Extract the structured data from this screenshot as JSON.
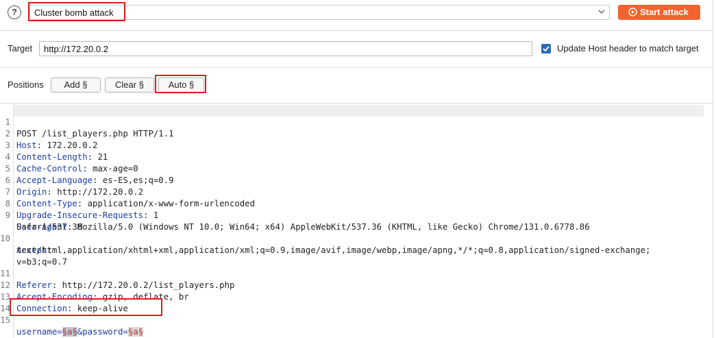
{
  "attack_type": {
    "help_icon": "question-circle-icon",
    "selected": "Cluster bomb attack",
    "start_button": "Start attack"
  },
  "target": {
    "label": "Target",
    "value": "http://172.20.0.2",
    "update_host_checked": true,
    "update_host_label": "Update Host header to match target"
  },
  "positions": {
    "label": "Positions",
    "add": "Add §",
    "clear": "Clear §",
    "auto": "Auto §"
  },
  "request": {
    "lines": [
      {
        "n": "1",
        "text": "POST /list_players.php HTTP/1.1"
      },
      {
        "n": "2",
        "key": "Host",
        "value": "172.20.0.2"
      },
      {
        "n": "3",
        "key": "Content-Length",
        "value": "21"
      },
      {
        "n": "4",
        "key": "Cache-Control",
        "value": "max-age=0"
      },
      {
        "n": "5",
        "key": "Accept-Language",
        "value": "es-ES,es;q=0.9"
      },
      {
        "n": "6",
        "key": "Origin",
        "value": "http://172.20.0.2"
      },
      {
        "n": "7",
        "key": "Content-Type",
        "value": "application/x-www-form-urlencoded"
      },
      {
        "n": "8",
        "key": "Upgrade-Insecure-Requests",
        "value": "1"
      },
      {
        "n": "9",
        "key": "User-Agent",
        "value": "Mozilla/5.0 (Windows NT 10.0; Win64; x64) AppleWebKit/537.36 (KHTML, like Gecko) Chrome/131.0.6778.86",
        "cont": "Safari/537.36"
      },
      {
        "n": "10",
        "key": "Accept",
        "value": "",
        "cont": "text/html,application/xhtml+xml,application/xml;q=0.9,image/avif,image/webp,image/apng,*/*;q=0.8,application/signed-exchange;",
        "cont2": "v=b3;q=0.7"
      },
      {
        "n": "11",
        "key": "Referer",
        "value": "http://172.20.0.2/list_players.php"
      },
      {
        "n": "12",
        "key": "Accept-Encoding",
        "value": "gzip, deflate, br"
      },
      {
        "n": "13",
        "key": "Connection",
        "value": "keep-alive"
      },
      {
        "n": "14",
        "text": ""
      },
      {
        "n": "15",
        "body_p1": "username=",
        "marker1": "§a§",
        "body_p2": "&password=",
        "marker2": "§a§"
      }
    ]
  },
  "colors": {
    "accent": "#f2632f",
    "highlight_box": "#e3161c",
    "header_key": "#1a3ea3",
    "checkbox": "#2b6cb8"
  }
}
